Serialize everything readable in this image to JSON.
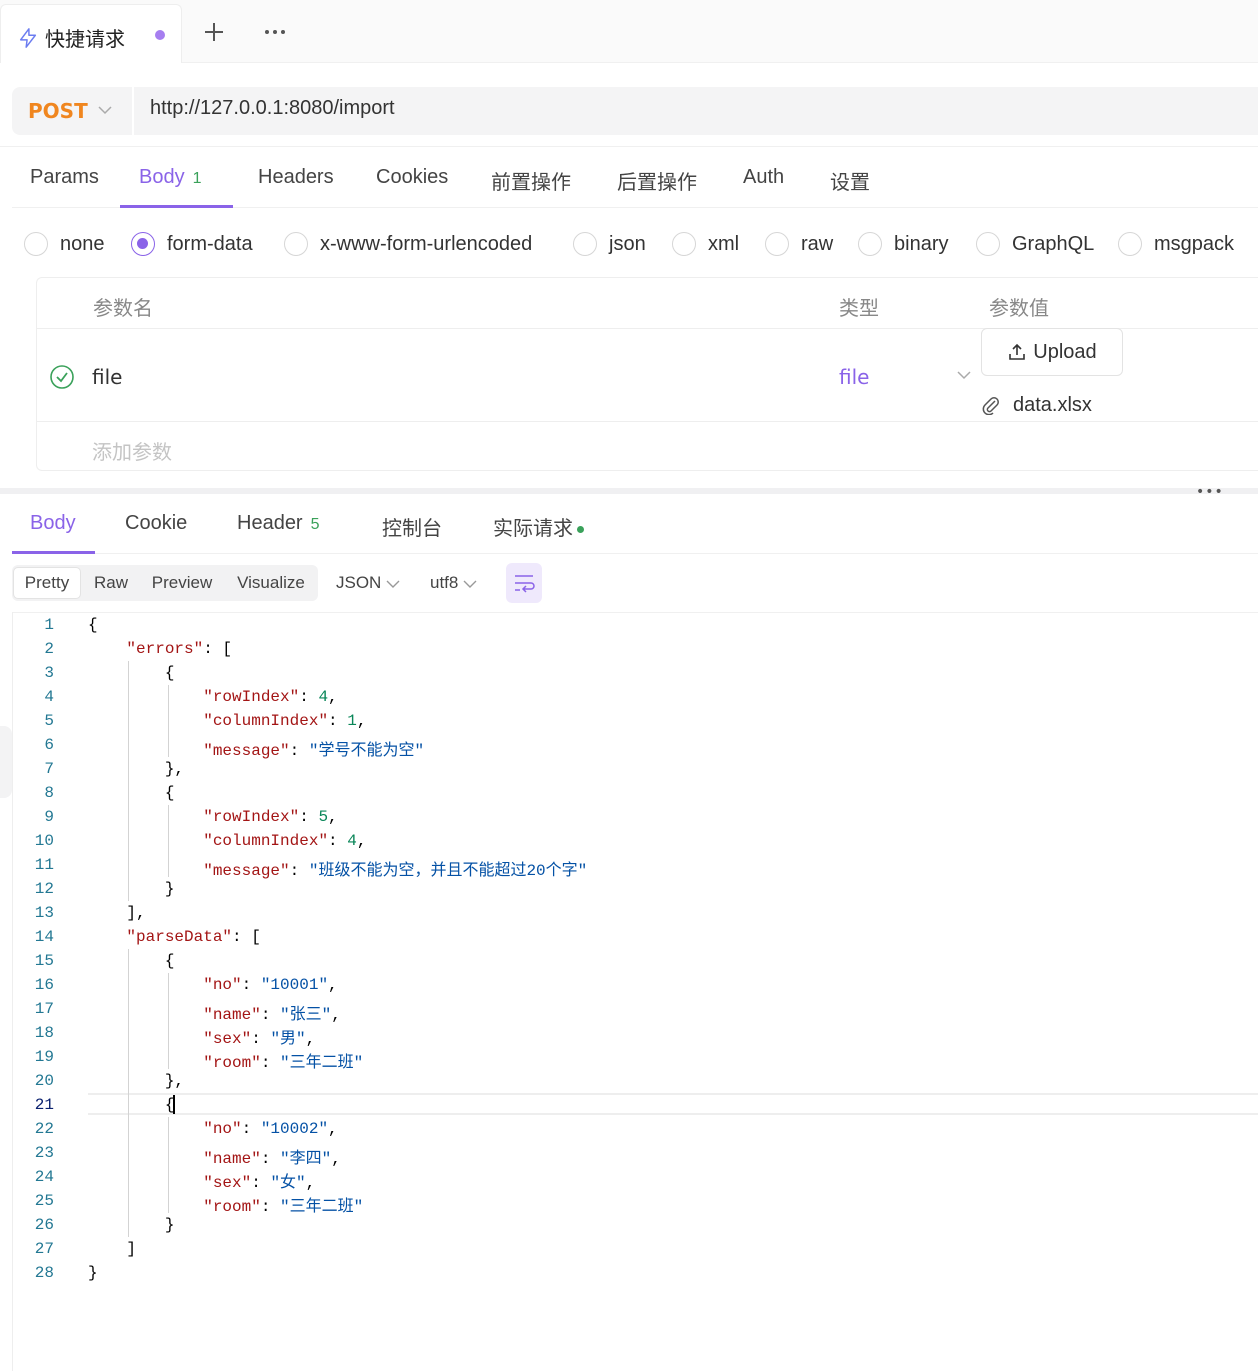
{
  "tab": {
    "title": "快捷请求"
  },
  "request": {
    "method": "POST",
    "url": "http://127.0.0.1:8080/import"
  },
  "request_tabs": [
    {
      "label": "Params"
    },
    {
      "label": "Body",
      "badge": "1"
    },
    {
      "label": "Headers"
    },
    {
      "label": "Cookies"
    },
    {
      "label": "前置操作"
    },
    {
      "label": "后置操作"
    },
    {
      "label": "Auth"
    },
    {
      "label": "设置"
    }
  ],
  "body_types": [
    "none",
    "form-data",
    "x-www-form-urlencoded",
    "json",
    "xml",
    "raw",
    "binary",
    "GraphQL",
    "msgpack"
  ],
  "selected_body_type": "form-data",
  "params_table": {
    "headers": {
      "name": "参数名",
      "type": "类型",
      "value": "参数值"
    },
    "rows": [
      {
        "name": "file",
        "type": "file",
        "upload_label": "Upload",
        "file_name": "data.xlsx",
        "enabled": true
      }
    ],
    "add_placeholder": "添加参数"
  },
  "response_tabs": [
    {
      "label": "Body"
    },
    {
      "label": "Cookie"
    },
    {
      "label": "Header",
      "badge": "5"
    },
    {
      "label": "控制台"
    },
    {
      "label": "实际请求"
    }
  ],
  "view_modes": [
    "Pretty",
    "Raw",
    "Preview",
    "Visualize"
  ],
  "format": "JSON",
  "encoding": "utf8",
  "code_lines": [
    "{",
    "    \"errors\": [",
    "        {",
    "            \"rowIndex\": 4,",
    "            \"columnIndex\": 1,",
    "            \"message\": \"学号不能为空\"",
    "        },",
    "        {",
    "            \"rowIndex\": 5,",
    "            \"columnIndex\": 4,",
    "            \"message\": \"班级不能为空，并且不能超过20个字\"",
    "        }",
    "    ],",
    "    \"parseData\": [",
    "        {",
    "            \"no\": \"10001\",",
    "            \"name\": \"张三\",",
    "            \"sex\": \"男\",",
    "            \"room\": \"三年二班\"",
    "        },",
    "        {",
    "            \"no\": \"10002\",",
    "            \"name\": \"李四\",",
    "            \"sex\": \"女\",",
    "            \"room\": \"三年二班\"",
    "        }",
    "    ]",
    "}"
  ],
  "current_line": 21,
  "colors": {
    "accent": "#8a63e8",
    "method": "#f0861f",
    "success": "#3aa15a"
  }
}
